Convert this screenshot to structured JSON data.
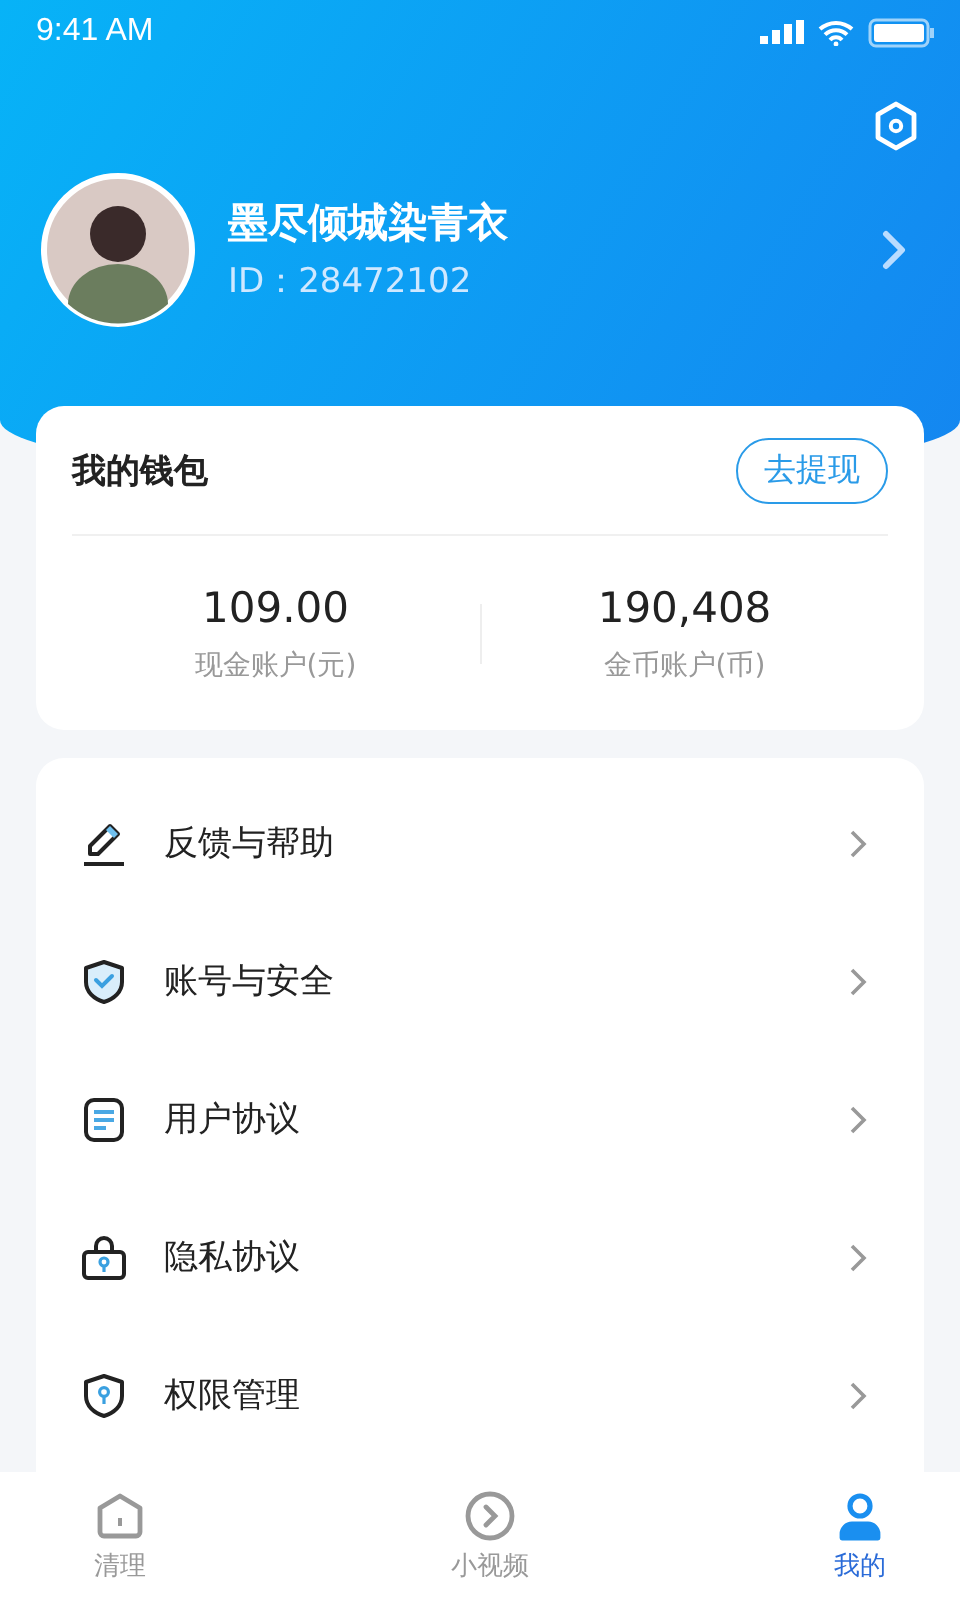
{
  "status_bar": {
    "time": "9:41 AM"
  },
  "profile": {
    "name": "墨尽倾城染青衣",
    "id": "ID：28472102"
  },
  "wallet": {
    "title": "我的钱包",
    "action": "去提现",
    "accounts": [
      {
        "value": "109.00",
        "label": "现金账户(元)"
      },
      {
        "value": "190,408",
        "label": "金币账户(币)"
      }
    ]
  },
  "menu": [
    {
      "kind": "pencil",
      "label": "反馈与帮助"
    },
    {
      "kind": "shield-check",
      "label": "账号与安全"
    },
    {
      "kind": "document",
      "label": "用户协议"
    },
    {
      "kind": "lock",
      "label": "隐私协议"
    },
    {
      "kind": "shield-key",
      "label": "权限管理"
    }
  ],
  "tabs": [
    {
      "kind": "home",
      "label": "清理",
      "selected": false
    },
    {
      "kind": "play",
      "label": "小视频",
      "selected": false
    },
    {
      "kind": "person",
      "label": "我的",
      "selected": true
    }
  ]
}
